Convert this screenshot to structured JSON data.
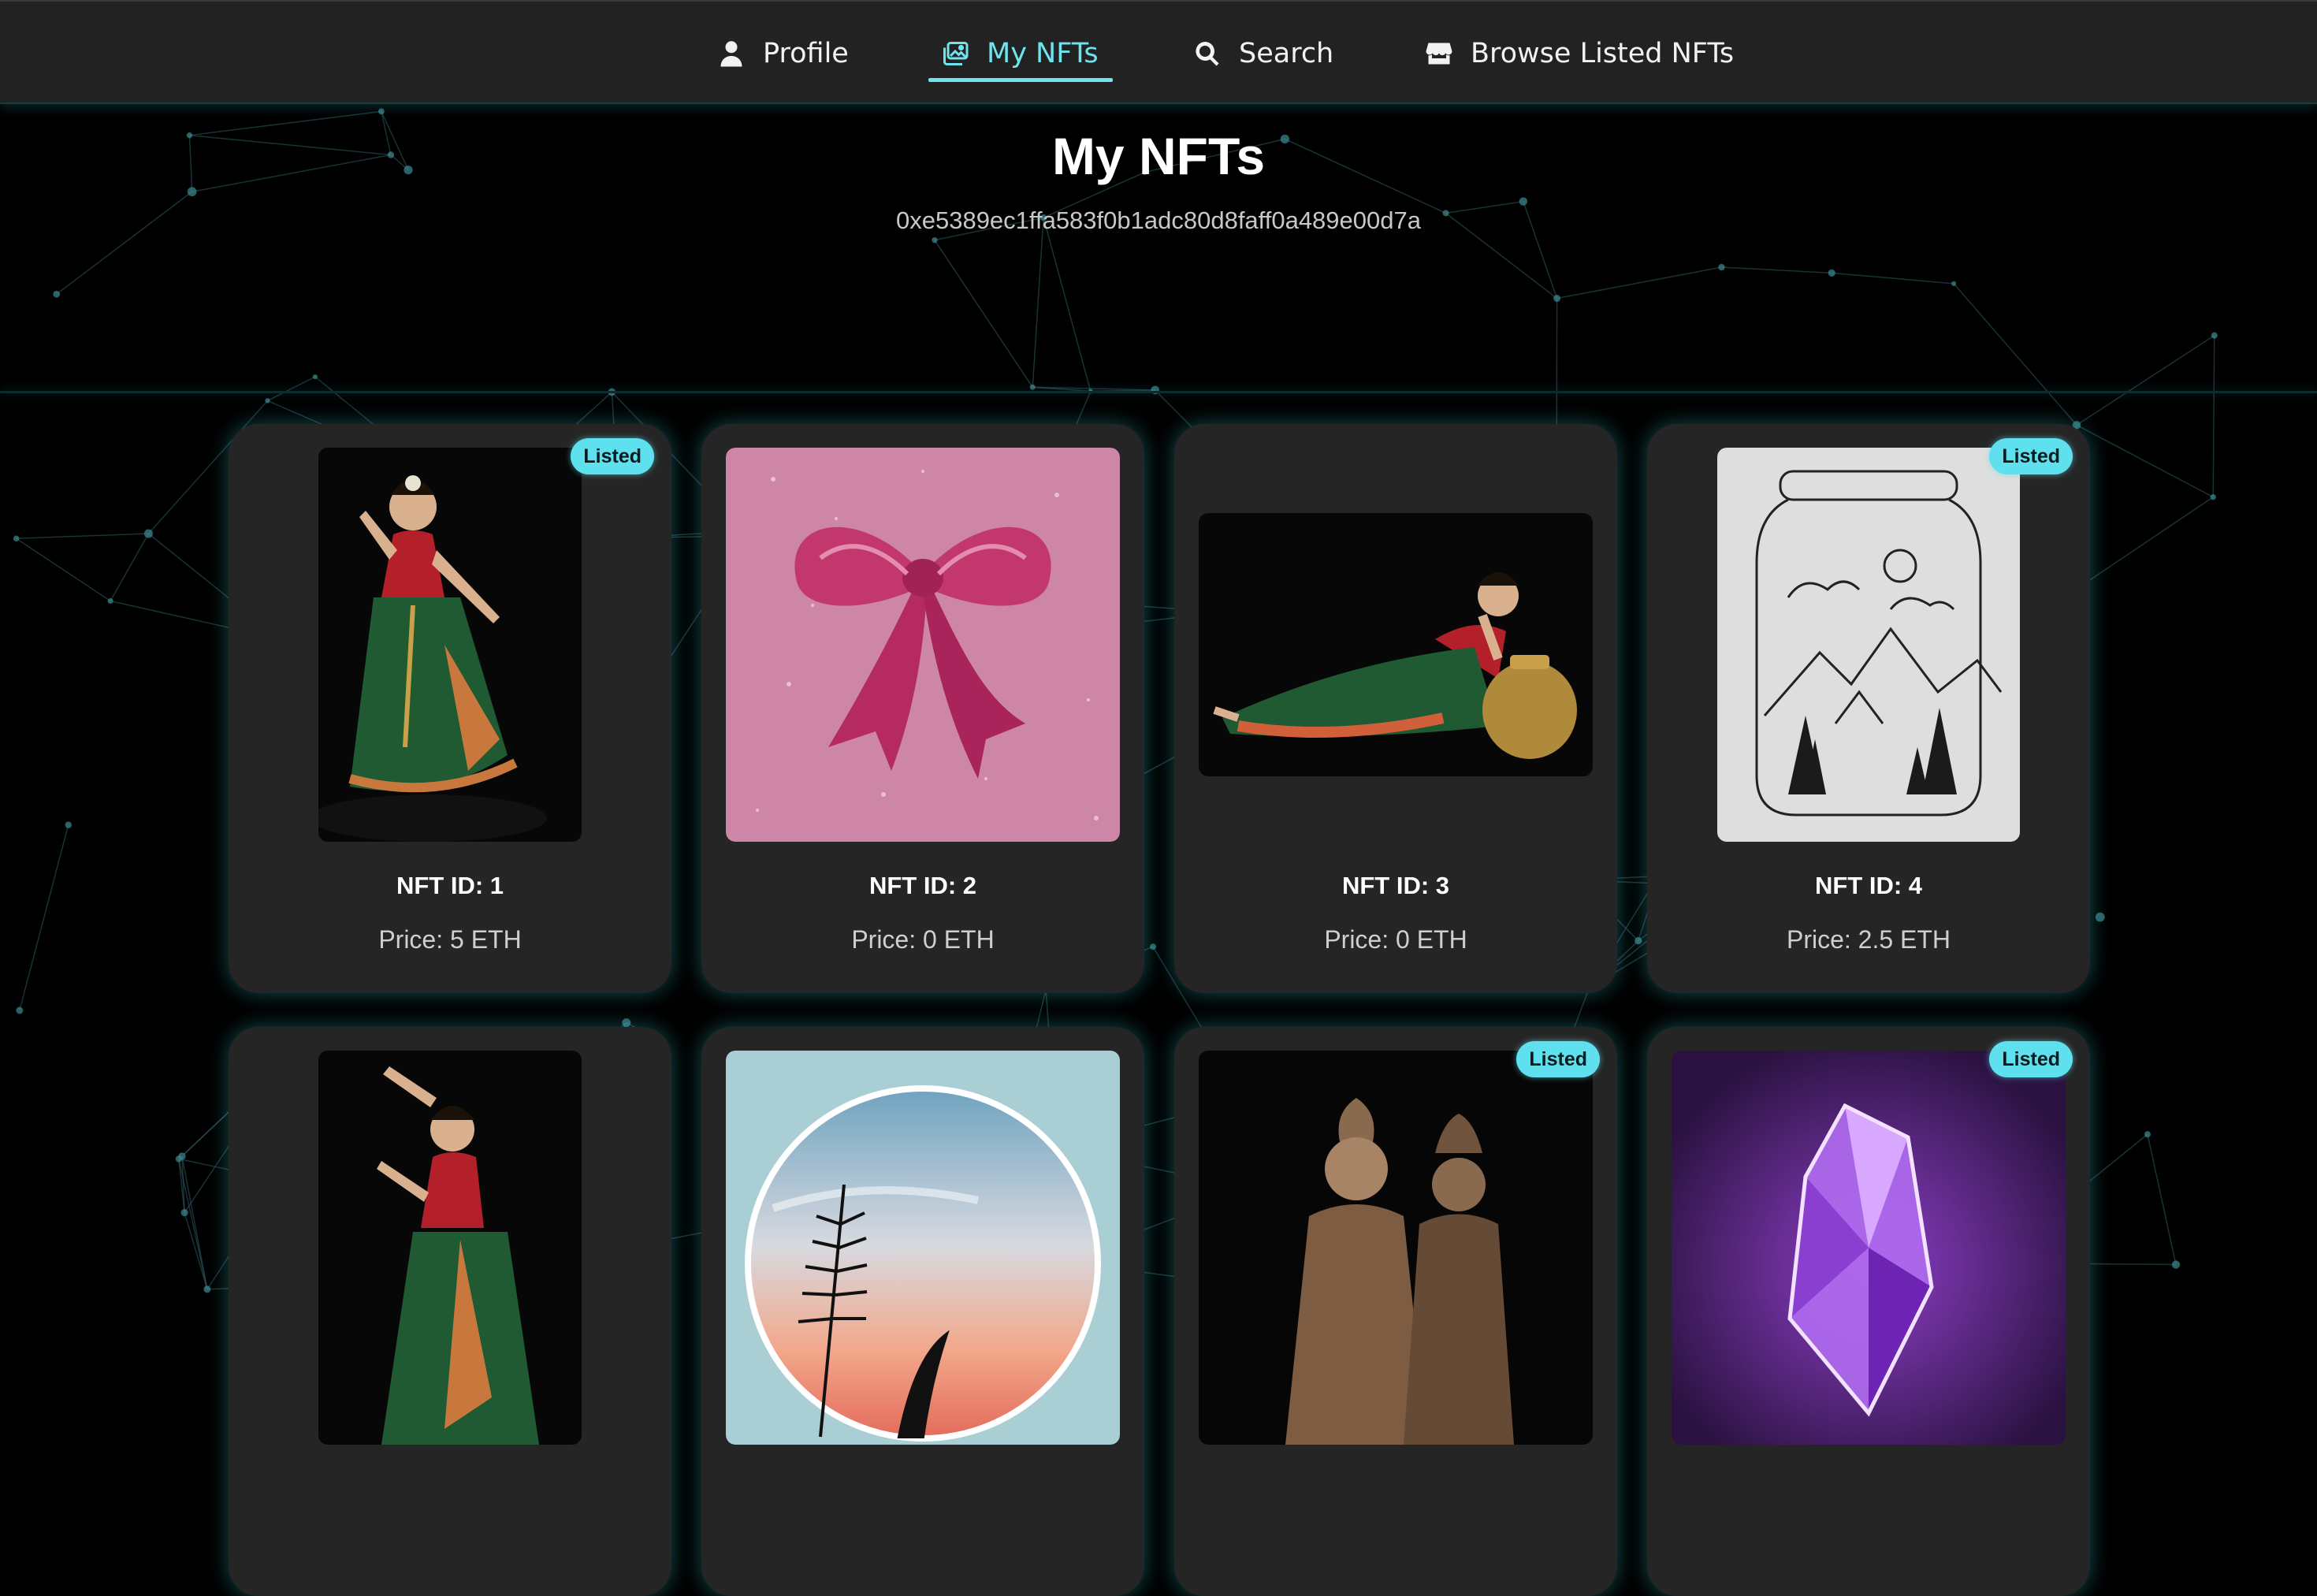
{
  "nav": {
    "items": [
      {
        "label": "Profile",
        "icon": "user-icon",
        "active": false
      },
      {
        "label": "My NFTs",
        "icon": "images-icon",
        "active": true
      },
      {
        "label": "Search",
        "icon": "search-icon",
        "active": false
      },
      {
        "label": "Browse Listed NFTs",
        "icon": "store-icon",
        "active": false
      }
    ]
  },
  "page": {
    "title": "My NFTs",
    "wallet_address": "0xe5389ec1ffa583f0b1adc80d8faff0a489e00d7a"
  },
  "colors": {
    "accent": "#5fe0ee",
    "card_bg": "#252525",
    "nav_bg": "#222222",
    "page_bg": "#000000"
  },
  "nfts": [
    {
      "id_label": "NFT ID: 1",
      "price_label": "Price: 5 ETH",
      "listed": true,
      "badge": "Listed",
      "image": "dancer-portrait"
    },
    {
      "id_label": "NFT ID: 2",
      "price_label": "Price: 0 ETH",
      "listed": false,
      "badge": "",
      "image": "pink-bow"
    },
    {
      "id_label": "NFT ID: 3",
      "price_label": "Price: 0 ETH",
      "listed": false,
      "badge": "",
      "image": "reclining-dancer"
    },
    {
      "id_label": "NFT ID: 4",
      "price_label": "Price: 2.5 ETH",
      "listed": true,
      "badge": "Listed",
      "image": "jar-landscape-sketch"
    },
    {
      "id_label": "",
      "price_label": "",
      "listed": false,
      "badge": "",
      "image": "dancer-pose"
    },
    {
      "id_label": "",
      "price_label": "",
      "listed": false,
      "badge": "",
      "image": "sunset-fern-circle"
    },
    {
      "id_label": "",
      "price_label": "",
      "listed": true,
      "badge": "Listed",
      "image": "sepia-statues"
    },
    {
      "id_label": "",
      "price_label": "",
      "listed": true,
      "badge": "Listed",
      "image": "purple-crystal"
    }
  ]
}
